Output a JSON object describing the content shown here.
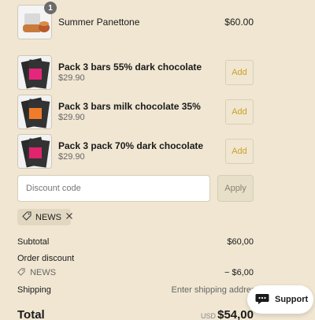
{
  "cart_item": {
    "quantity": "1",
    "name": "Summer Panettone",
    "price": "$60.00"
  },
  "upsells": [
    {
      "name": "Pack 3 bars 55% dark chocolate",
      "price": "$29.90",
      "add_label": "Add",
      "accent": "#e6267a"
    },
    {
      "name": "Pack 3 bars milk chocolate 35%",
      "price": "$29.90",
      "add_label": "Add",
      "accent": "#f07c2a"
    },
    {
      "name": "Pack 3 pack 70% dark chocolate",
      "price": "$29.90",
      "add_label": "Add",
      "accent": "#e0246e"
    }
  ],
  "discount": {
    "placeholder": "Discount code",
    "apply_label": "Apply",
    "applied_code": "NEWS"
  },
  "summary": {
    "subtotal_label": "Subtotal",
    "subtotal_value": "$60,00",
    "order_discount_label": "Order discount",
    "discount_code": "NEWS",
    "discount_value": "− $6,00",
    "shipping_label": "Shipping",
    "shipping_value": "Enter shipping address",
    "total_label": "Total",
    "currency": "USD",
    "total_value": "$54,00"
  },
  "support": {
    "label": "Support"
  },
  "colors": {
    "background": "#f0e6d2",
    "add_accent": "#c9a227",
    "tag_bg": "#e2d8c2"
  }
}
